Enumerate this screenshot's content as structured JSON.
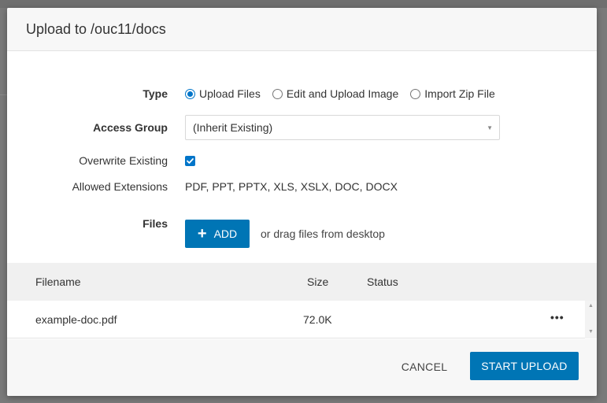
{
  "dialog": {
    "title": "Upload to /ouc11/docs"
  },
  "form": {
    "type": {
      "label": "Type",
      "options": [
        {
          "label": "Upload Files",
          "checked": true
        },
        {
          "label": "Edit and Upload Image",
          "checked": false
        },
        {
          "label": "Import Zip File",
          "checked": false
        }
      ]
    },
    "access_group": {
      "label": "Access Group",
      "selected": "(Inherit Existing)"
    },
    "overwrite": {
      "label": "Overwrite Existing",
      "checked": true
    },
    "allowed_extensions": {
      "label": "Allowed Extensions",
      "values": [
        "PDF,",
        "PPT,",
        "PPTX,",
        "XLS,",
        "XSLX,",
        "DOC,",
        "DOCX"
      ]
    },
    "files": {
      "label": "Files",
      "add_label": "ADD",
      "drag_text": "or drag files from desktop"
    }
  },
  "table": {
    "headers": {
      "filename": "Filename",
      "size": "Size",
      "status": "Status"
    },
    "rows": [
      {
        "filename": "example-doc.pdf",
        "size": "72.0K",
        "status": ""
      }
    ]
  },
  "footer": {
    "cancel_label": "CANCEL",
    "start_label": "START UPLOAD"
  },
  "colors": {
    "accent": "#0075b5",
    "header_bg": "#f7f7f7"
  }
}
